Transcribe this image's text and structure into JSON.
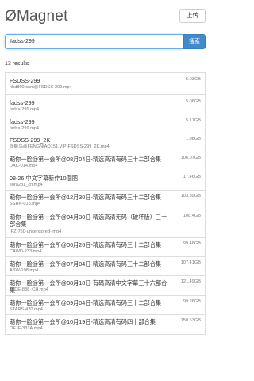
{
  "header": {
    "logo": "ØMagnet",
    "upload_label": "上传"
  },
  "search": {
    "value": "fadss-299",
    "button_label": "搜索"
  },
  "results_count": "13 results",
  "results": [
    {
      "title": "FSDSS-299",
      "file": "hhd800.com@FSDSS-299.mp4",
      "size": "5.03GB"
    },
    {
      "title": "fadss-299",
      "file": "fadss-299.mp4",
      "size": "5.06GB"
    },
    {
      "title": "fadss-299",
      "file": "fadss-299.mp4",
      "size": "5.17GB"
    },
    {
      "title": "FSDSS-299_2K",
      "file": "@蜂鸟@FENGNIAO151.VIP-FSDSS-299_2K.mp4",
      "size": "1.98GB"
    },
    {
      "title": "萌你一脸@第一会所@08月04日-精选高清有码三十二部合集",
      "file": "DAC-014.mp4",
      "size": "106.07GB"
    },
    {
      "title": "08-26 中文字幕新作10個肥",
      "file": "sora281_ch.mp4",
      "size": "17.46GB"
    },
    {
      "title": "萌你一脸@第一会所@12月30日-精选高清有码三十二部合集",
      "file": "SSHN-018.mp4",
      "size": "103.39GB"
    },
    {
      "title": "萌你一脸@第一会所@04月30日-精选高清无码（破坏版）三十部合集",
      "file": "IPZ-760-uncensored-.mp4",
      "size": "108.4GB"
    },
    {
      "title": "萌你一脸@第一会所@06月26日-精选高清有码三十二部合集",
      "file": "CAWD-233.mp4",
      "size": "99.46GB"
    },
    {
      "title": "萌你一脸@第一会所@07月04日-精选高清有码三十二部合集",
      "file": "ABW-108.mp4",
      "size": "107.41GB"
    },
    {
      "title": "萌你一脸@第一会所@08月18日-有碼高清中文字幕三十六部合集",
      "file": "MIDE-888_CH.mp4",
      "size": "121.49GB"
    },
    {
      "title": "萌你一脸@第一会所@09月04日-精选高清有码三十二部合集",
      "file": "STARS-420.mp4",
      "size": "99.26GB"
    },
    {
      "title": "萌你一脸@第一会所@10月19日-精选高清有码四十部合集",
      "file": "OFJE-333A.mp4",
      "size": "150.63GB"
    }
  ]
}
